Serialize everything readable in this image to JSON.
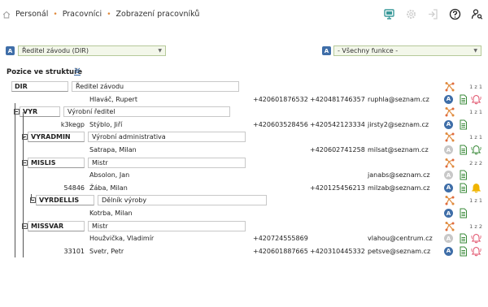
{
  "breadcrumb": [
    "Personál",
    "Pracovníci",
    "Zobrazení pracovníků"
  ],
  "header_icons": [
    "monitor-icon",
    "settings-icon",
    "logout-icon",
    "help-icon",
    "user-search-icon"
  ],
  "filters": {
    "unit_badge": "A",
    "unit_value": "Ředitel závodu (DIR)",
    "function_badge": "A",
    "function_value": "- Všechny funkce -"
  },
  "section_title": "Pozice ve struktuře",
  "colors": {
    "accent_blue": "#3f6ea8",
    "alarm_red": "#e0506a",
    "alarm_yellow": "#f0b400",
    "orange": "#e08a3c",
    "green": "#3a8a3a"
  },
  "rows": [
    {
      "type": "position",
      "code": "DIR",
      "name": "Ředitel závodu",
      "count": "1 z 1"
    },
    {
      "type": "person",
      "id": "",
      "name": "Hlaváč, Rupert",
      "phone1": "+420601876532",
      "phone2": "+420481746357",
      "email": "ruphla@seznam.cz",
      "status": "on",
      "alarm": "red"
    },
    {
      "type": "position",
      "code": "VYR",
      "name": "Výrobní ředitel",
      "count": "1 z 1"
    },
    {
      "type": "person",
      "id": "k3kegp",
      "name": "Stýblo, Jiří",
      "phone1": "+420603528456",
      "phone2": "+420542123334",
      "email": "jirsty2@seznam.cz",
      "status": "on",
      "alarm": "none"
    },
    {
      "type": "position",
      "code": "VYRADMIN",
      "name": "Výrobní administrativa",
      "count": "1 z 1"
    },
    {
      "type": "person",
      "id": "",
      "name": "Satrapa, Milan",
      "phone1": "",
      "phone2": "+420602741258",
      "email": "milsat@seznam.cz",
      "status": "off",
      "alarm": "green"
    },
    {
      "type": "position",
      "code": "MISLIS",
      "name": "Mistr",
      "count": "2 z 2"
    },
    {
      "type": "person",
      "id": "",
      "name": "Absolon, Jan",
      "phone1": "",
      "phone2": "",
      "email": "janabs@seznam.cz",
      "status": "off",
      "alarm": "none"
    },
    {
      "type": "person",
      "id": "54846",
      "name": "Žába, Milan",
      "phone1": "",
      "phone2": "+420125456213",
      "email": "milzab@seznam.cz",
      "status": "on",
      "alarm": "yellow"
    },
    {
      "type": "position",
      "code": "VYRDELLIS",
      "name": "Dělník výroby",
      "count": "1 z 1"
    },
    {
      "type": "person",
      "id": "",
      "name": "Kotrba, Milan",
      "phone1": "",
      "phone2": "",
      "email": "",
      "status": "on",
      "alarm": "none"
    },
    {
      "type": "position",
      "code": "MISSVAR",
      "name": "Mistr",
      "count": "1 z 2"
    },
    {
      "type": "person",
      "id": "",
      "name": "Houžvička, Vladimír",
      "phone1": "+420724555869",
      "phone2": "",
      "email": "vlahou@centrum.cz",
      "status": "off",
      "alarm": "red"
    },
    {
      "type": "person",
      "id": "33101",
      "name": "Svetr, Petr",
      "phone1": "+420601887665",
      "phone2": "+420310445332",
      "email": "petsve@seznam.cz",
      "status": "on",
      "alarm": "red"
    }
  ]
}
